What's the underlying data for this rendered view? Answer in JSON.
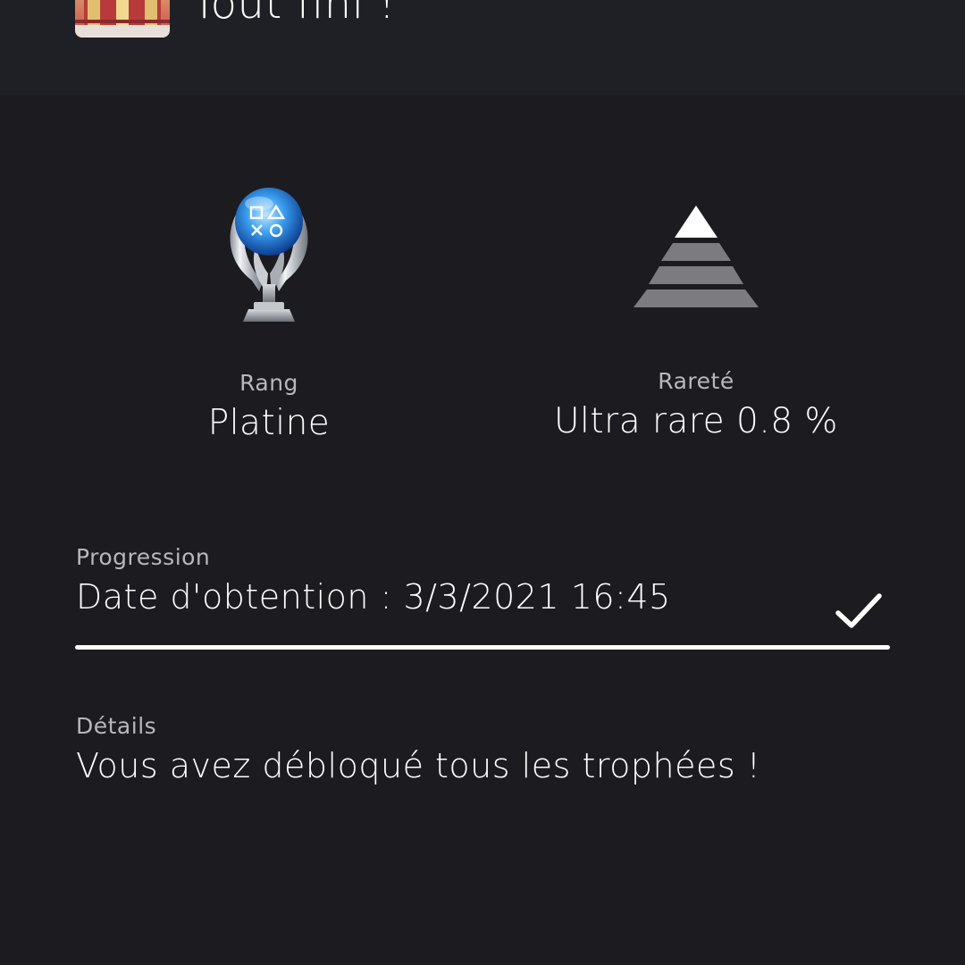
{
  "header": {
    "trophy_name": "Tout fini !",
    "game_thumbnail": "game-cover-art"
  },
  "stats": {
    "rank": {
      "icon": "platinum-trophy-icon",
      "label": "Rang",
      "value": "Platine"
    },
    "rarity": {
      "icon": "ultra-rare-pyramid-icon",
      "label": "Rareté",
      "value": "Ultra rare 0.8 %"
    }
  },
  "progression": {
    "label": "Progression",
    "date_text": "Date d'obtention : 3/3/2021  16:45",
    "progress_fraction": 1.0,
    "status_icon": "checkmark-icon"
  },
  "details": {
    "label": "Détails",
    "text": "Vous avez débloqué tous les trophées !"
  },
  "colors": {
    "background": "#1b1b20",
    "header_background": "#1f2025",
    "progress_fill": "#ffffff",
    "secondary_text": "#b8b8bc"
  }
}
